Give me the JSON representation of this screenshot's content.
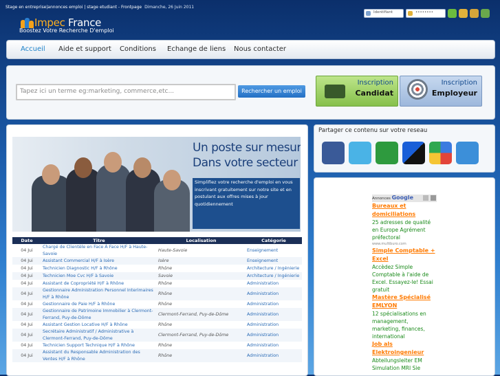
{
  "top": {
    "breadcrumb": "Stage en entreprise|annonces emploi | stage etudiant - Frontpage",
    "date": "Dimanche, 26 Juin 2011",
    "login_placeholder": "Identifiant",
    "password_placeholder": "••••••••"
  },
  "logo": {
    "name_a": "Impec",
    "name_b": " France",
    "slogan": "Boostez Votre Recherche D'emploi"
  },
  "nav": {
    "items": [
      "Accueil",
      "Aide et support",
      "Conditions",
      "Echange de liens",
      "Nous contacter"
    ]
  },
  "search": {
    "placeholder": "Tapez ici un terme eg:marketing, commerce,etc...",
    "button": "Rechercher un emploi",
    "cand_l1": "Inscription",
    "cand_l2": "Candidat",
    "emp_l1": "Inscription",
    "emp_l2": "Employeur"
  },
  "banner": {
    "h1": "Un poste sur mesure",
    "h2": "Dans votre secteur",
    "body": "Simplifiez votre recherche d'emploi en vous inscrivant gratuitement sur notre site et en postulant aux offres mises à jour quotidiennement"
  },
  "table": {
    "headers": [
      "Date",
      "Titre",
      "Localisation",
      "Catégorie"
    ],
    "rows": [
      {
        "date": "04 Jui",
        "title": "Chargé de Clientèle en Face À Face H/F à Haute-Savoie",
        "loc": "Haute-Savoie",
        "cat": "Enseignement"
      },
      {
        "date": "04 Jui",
        "title": "Assistant Commercial H/F à Isère",
        "loc": "Isère",
        "cat": "Enseignement"
      },
      {
        "date": "04 Jui",
        "title": "Technicien Diagnostic H/F à Rhône",
        "loc": "Rhône",
        "cat": "Architecture / Ingénierie"
      },
      {
        "date": "04 Jui",
        "title": "Technicien Moe Cvc H/F à Savoie",
        "loc": "Savoie",
        "cat": "Architecture / Ingénierie"
      },
      {
        "date": "04 Jui",
        "title": "Assistant de Copropriété H/F à Rhône",
        "loc": "Rhône",
        "cat": "Administration"
      },
      {
        "date": "04 Jui",
        "title": "Gestionnaire Administration Personnel Interimaires H/F à Rhône",
        "loc": "Rhône",
        "cat": "Administration"
      },
      {
        "date": "04 Jui",
        "title": "Gestionnaire de Paie H/F à Rhône",
        "loc": "Rhône",
        "cat": "Administration"
      },
      {
        "date": "04 Jui",
        "title": "Gestionnaire de Patrimoine Immobilier à Clermont-Ferrand, Puy-de-Dôme",
        "loc": "Clermont-Ferrand, Puy-de-Dôme",
        "cat": "Administration"
      },
      {
        "date": "04 Jui",
        "title": "Assistant Gestion Locative H/F à Rhône",
        "loc": "Rhône",
        "cat": "Administration"
      },
      {
        "date": "04 Jui",
        "title": "Secrétaire Administratif / Administrative à Clermont-Ferrand, Puy-de-Dôme",
        "loc": "Clermont-Ferrand, Puy-de-Dôme",
        "cat": "Administration"
      },
      {
        "date": "04 Jui",
        "title": "Technicien Support Technique H/F à Rhône",
        "loc": "Rhône",
        "cat": "Administration"
      },
      {
        "date": "04 Jui",
        "title": "Assistant du Responsable Administration des Ventes H/F à Rhône",
        "loc": "Rhône",
        "cat": "Administration"
      }
    ]
  },
  "share": {
    "title": "Partager ce contenu sur votre reseau"
  },
  "ads": {
    "label": "Annonces",
    "google": "Google",
    "items": [
      {
        "t": "Bureaux et domiciliations",
        "d": "25 adresses de qualité en Europe Agrément préfectoral",
        "u": "www.multiburo.com"
      },
      {
        "t": "Simple Comptable + Excel",
        "d": "Accèdez Simple Comptable à l'aide de Excel. Essayez-le! Essai gratuit",
        "u": ""
      },
      {
        "t": "Mastère Spécialisé EMLYON",
        "d": "12 spécialisations en management, marketing, finances, international",
        "u": ""
      },
      {
        "t": "Job als Elektroingenieur",
        "d": "Abteilungsleiter EM Simulation MRI Sie",
        "u": ""
      }
    ]
  }
}
